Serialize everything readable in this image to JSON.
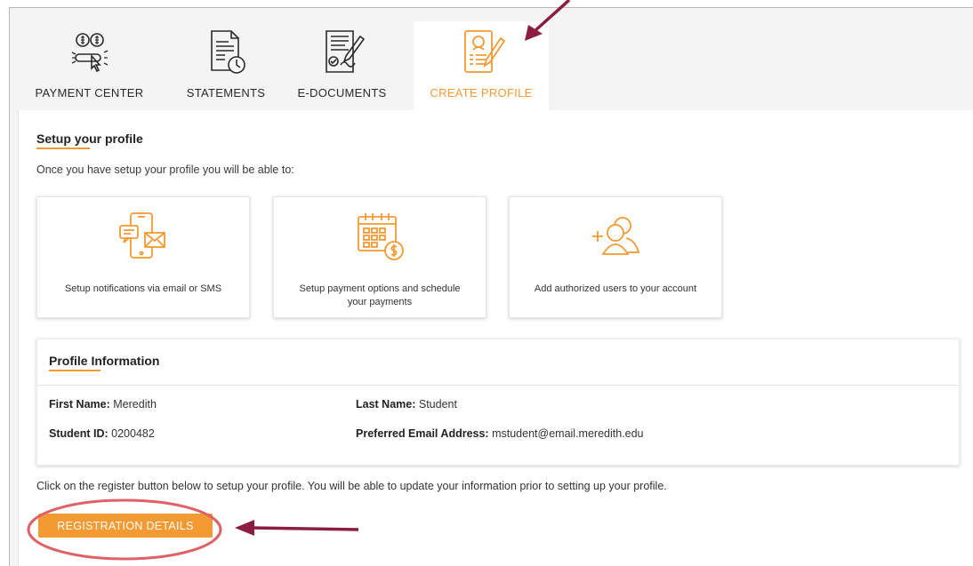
{
  "tabs": [
    {
      "label": "PAYMENT CENTER",
      "icon": "payment-center-icon"
    },
    {
      "label": "STATEMENTS",
      "icon": "statements-icon"
    },
    {
      "label": "E-DOCUMENTS",
      "icon": "e-documents-icon"
    },
    {
      "label": "CREATE PROFILE",
      "icon": "create-profile-icon",
      "active": true
    }
  ],
  "setup": {
    "title": "Setup your profile",
    "subtitle": "Once you have setup your profile you will be able to:"
  },
  "features": [
    {
      "text": "Setup notifications via email or SMS",
      "icon": "notifications-icon"
    },
    {
      "text": "Setup payment options and schedule your payments",
      "icon": "calendar-payment-icon"
    },
    {
      "text": "Add authorized users to your account",
      "icon": "add-users-icon"
    }
  ],
  "profile": {
    "title": "Profile Information",
    "first_name_label": "First Name:",
    "first_name": "Meredith",
    "last_name_label": "Last Name:",
    "last_name": "Student",
    "student_id_label": "Student ID:",
    "student_id": "0200482",
    "email_label": "Preferred Email Address:",
    "email": "mstudent@email.meredith.edu"
  },
  "register_note": "Click on the register button below to setup your profile. You will be able to update your information prior to setting up your profile.",
  "register_button": "REGISTRATION DETAILS",
  "colors": {
    "accent": "#f39a33",
    "annotation": "#8b1e3f",
    "highlight_ring": "#e06068"
  }
}
